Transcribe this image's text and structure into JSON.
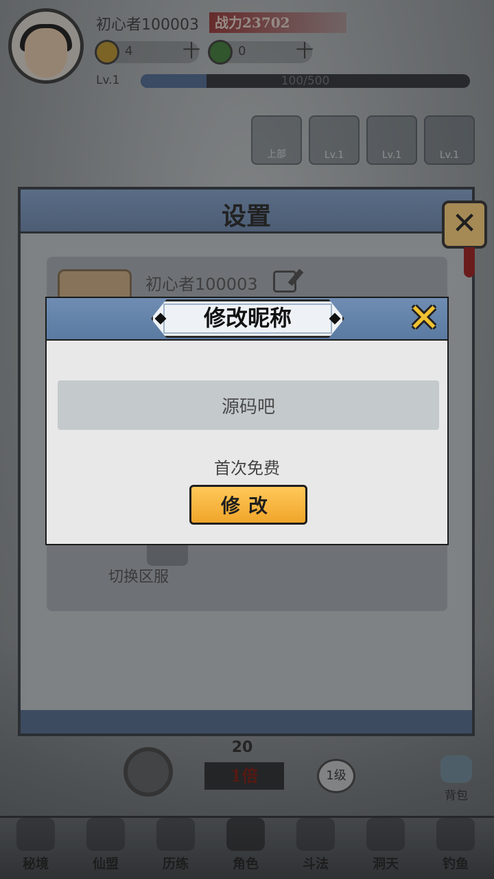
{
  "hud": {
    "player_name": "初心者100003",
    "power_label": "战力23702",
    "coins": "4",
    "jade": "0",
    "plus": "十",
    "level": "Lv.1",
    "exp_text": "100/500",
    "exp_progress": 0.2
  },
  "equipment_slots": [
    {
      "label": "上部"
    },
    {
      "label": "Lv.1"
    },
    {
      "label": "Lv.1"
    },
    {
      "label": "Lv.1"
    }
  ],
  "battle": {
    "speed_count": "20",
    "speed_label": "1倍",
    "level_pill": "1级",
    "bag_label": "背包"
  },
  "nav": {
    "items": [
      {
        "label": "秘境"
      },
      {
        "label": "仙盟"
      },
      {
        "label": "历练"
      },
      {
        "label": "角色"
      },
      {
        "label": "斗法"
      },
      {
        "label": "洞天"
      },
      {
        "label": "钓鱼"
      }
    ]
  },
  "settings": {
    "title": "设置",
    "profile_name": "初心者100003",
    "switch_server_label": "切换区服",
    "close_icon": "close-icon"
  },
  "rename_modal": {
    "title": "修改昵称",
    "name_value": "源码吧",
    "fee_note": "首次免费",
    "confirm_label": "修改",
    "close_icon": "close-x-icon"
  },
  "colors": {
    "modal_header": "#5b7aa1",
    "confirm_button": "#f0a52a",
    "close_x": "#f1c232"
  }
}
